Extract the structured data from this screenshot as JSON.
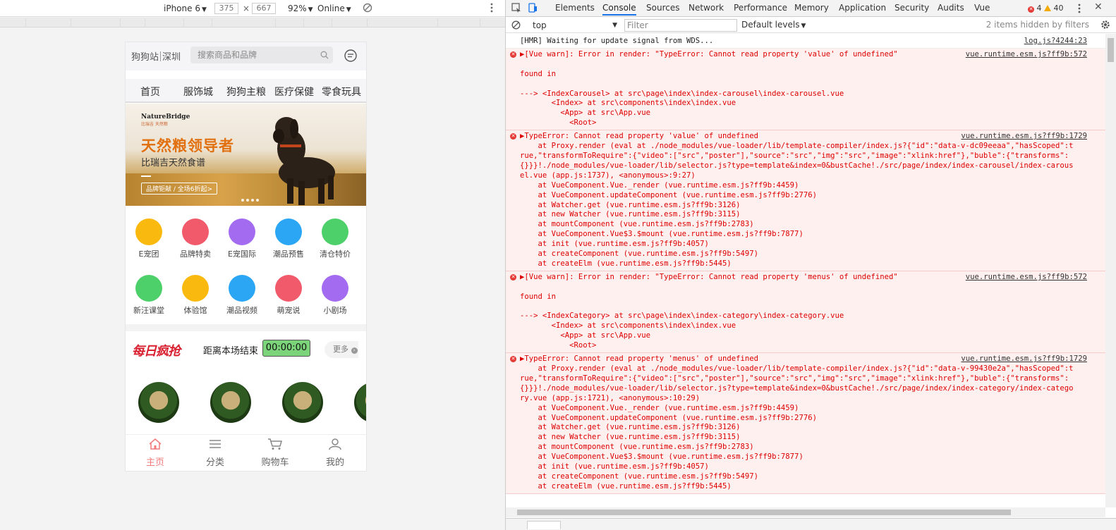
{
  "device_toolbar": {
    "device": "iPhone 6",
    "width": "375",
    "times": "×",
    "height": "667",
    "zoom": "92%",
    "network": "Online"
  },
  "phone": {
    "location": {
      "site": "狗狗站",
      "city": "深圳"
    },
    "search_placeholder": "搜索商品和品牌",
    "nav": [
      "首页",
      "服饰城",
      "狗狗主粮",
      "医疗保健",
      "零食玩具"
    ],
    "banner": {
      "brand": "NatureBridge",
      "brand_sub": "比瑞吉 天然粮",
      "headline": "天然粮领导者",
      "subline": "比瑞吉天然食谱",
      "button": "品牌钜献 / 全场6折起>"
    },
    "icons": [
      {
        "label": "E宠团",
        "color": "#f9b90e"
      },
      {
        "label": "品牌特卖",
        "color": "#f05a6a"
      },
      {
        "label": "E宠国际",
        "color": "#a36bf0"
      },
      {
        "label": "潮品预售",
        "color": "#2aa6f4"
      },
      {
        "label": "清仓特价",
        "color": "#4dd06a"
      },
      {
        "label": "新汪课堂",
        "color": "#4dd06a"
      },
      {
        "label": "体验馆",
        "color": "#f9b90e"
      },
      {
        "label": "潮品视频",
        "color": "#2aa6f4"
      },
      {
        "label": "萌宠说",
        "color": "#f05a6a"
      },
      {
        "label": "小剧场",
        "color": "#a36bf0"
      }
    ],
    "flash": {
      "logo": "每日疯抢",
      "ends_label": "距离本场结束",
      "timer": "00:00:00",
      "more": "更多"
    },
    "tabbar": [
      {
        "label": "主页",
        "icon": "home-icon",
        "active": true
      },
      {
        "label": "分类",
        "icon": "list-icon",
        "active": false
      },
      {
        "label": "购物车",
        "icon": "cart-icon",
        "active": false
      },
      {
        "label": "我的",
        "icon": "user-icon",
        "active": false
      }
    ]
  },
  "devtools": {
    "tabs": [
      "Elements",
      "Console",
      "Sources",
      "Network",
      "Performance",
      "Memory",
      "Application",
      "Security",
      "Audits",
      "Vue"
    ],
    "active_tab": "Console",
    "error_count": "4",
    "warning_count": "40",
    "context": "top",
    "filter_placeholder": "Filter",
    "levels": "Default levels",
    "hidden_info": "2 items hidden by filters",
    "messages": [
      {
        "type": "info",
        "text": "[HMR] Waiting for update signal from WDS...",
        "source": "log.js?4244:23"
      },
      {
        "type": "error",
        "text": "▶[Vue warn]: Error in render: \"TypeError: Cannot read property 'value' of undefined\"\n\nfound in\n\n---> <IndexCarousel> at src\\page\\index\\index-carousel\\index-carousel.vue\n       <Index> at src\\components\\index\\index.vue\n         <App> at src\\App.vue\n           <Root>",
        "source": "vue.runtime.esm.js?ff9b:572"
      },
      {
        "type": "error",
        "text": "▶TypeError: Cannot read property 'value' of undefined\n    at Proxy.render (eval at ./node_modules/vue-loader/lib/template-compiler/index.js?{\"id\":\"data-v-dc09eeaa\",\"hasScoped\":true,\"transformToRequire\":{\"video\":[\"src\",\"poster\"],\"source\":\"src\",\"img\":\"src\",\"image\":\"xlink:href\"},\"buble\":{\"transforms\":{}}}!./node_modules/vue-loader/lib/selector.js?type=template&index=0&bustCache!./src/page/index/index-carousel/index-carousel.vue (app.js:1737), <anonymous>:9:27)\n    at VueComponent.Vue._render (vue.runtime.esm.js?ff9b:4459)\n    at VueComponent.updateComponent (vue.runtime.esm.js?ff9b:2776)\n    at Watcher.get (vue.runtime.esm.js?ff9b:3126)\n    at new Watcher (vue.runtime.esm.js?ff9b:3115)\n    at mountComponent (vue.runtime.esm.js?ff9b:2783)\n    at VueComponent.Vue$3.$mount (vue.runtime.esm.js?ff9b:7877)\n    at init (vue.runtime.esm.js?ff9b:4057)\n    at createComponent (vue.runtime.esm.js?ff9b:5497)\n    at createElm (vue.runtime.esm.js?ff9b:5445)",
        "source": "vue.runtime.esm.js?ff9b:1729"
      },
      {
        "type": "error",
        "text": "▶[Vue warn]: Error in render: \"TypeError: Cannot read property 'menus' of undefined\"\n\nfound in\n\n---> <IndexCategory> at src\\page\\index\\index-category\\index-category.vue\n       <Index> at src\\components\\index\\index.vue\n         <App> at src\\App.vue\n           <Root>",
        "source": "vue.runtime.esm.js?ff9b:572"
      },
      {
        "type": "error",
        "text": "▶TypeError: Cannot read property 'menus' of undefined\n    at Proxy.render (eval at ./node_modules/vue-loader/lib/template-compiler/index.js?{\"id\":\"data-v-99430e2a\",\"hasScoped\":true,\"transformToRequire\":{\"video\":[\"src\",\"poster\"],\"source\":\"src\",\"img\":\"src\",\"image\":\"xlink:href\"},\"buble\":{\"transforms\":{}}}!./node_modules/vue-loader/lib/selector.js?type=template&index=0&bustCache!./src/page/index/index-category/index-category.vue (app.js:1721), <anonymous>:10:29)\n    at VueComponent.Vue._render (vue.runtime.esm.js?ff9b:4459)\n    at VueComponent.updateComponent (vue.runtime.esm.js?ff9b:2776)\n    at Watcher.get (vue.runtime.esm.js?ff9b:3126)\n    at new Watcher (vue.runtime.esm.js?ff9b:3115)\n    at mountComponent (vue.runtime.esm.js?ff9b:2783)\n    at VueComponent.Vue$3.$mount (vue.runtime.esm.js?ff9b:7877)\n    at init (vue.runtime.esm.js?ff9b:4057)\n    at createComponent (vue.runtime.esm.js?ff9b:5497)\n    at createElm (vue.runtime.esm.js?ff9b:5445)",
        "source": "vue.runtime.esm.js?ff9b:1729"
      }
    ]
  }
}
